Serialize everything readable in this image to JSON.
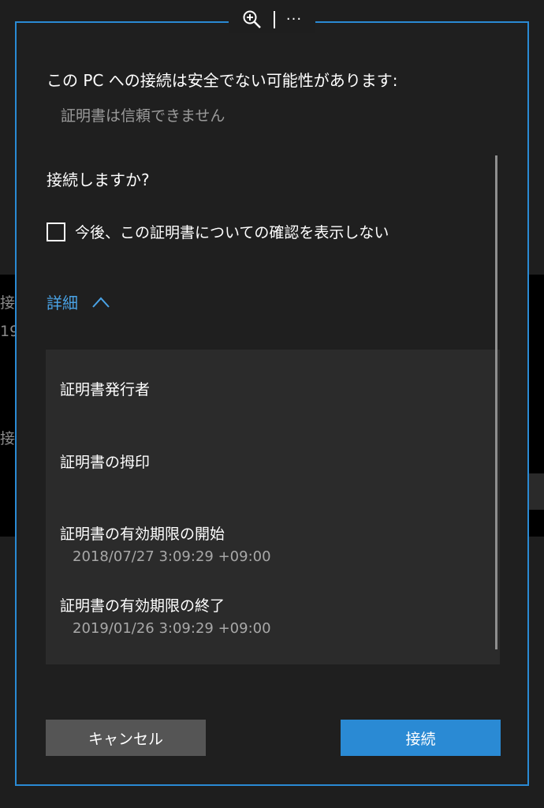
{
  "background": {
    "text_1": "接",
    "text_2": "19",
    "text_3": "接"
  },
  "topbar": {
    "zoom_icon": "zoom-in-icon",
    "more_label": "···"
  },
  "dialog": {
    "title": "この PC への接続は安全でない可能性があります:",
    "subtitle": "証明書は信頼できません",
    "question": "接続しますか?",
    "checkbox_label": "今後、この証明書についての確認を表示しない",
    "details_toggle_label": "詳細",
    "details": [
      {
        "label": "証明書発行者",
        "value": ""
      },
      {
        "label": "証明書の拇印",
        "value": ""
      },
      {
        "label": "証明書の有効期限の開始",
        "value": "2018/07/27 3:09:29 +09:00"
      },
      {
        "label": "証明書の有効期限の終了",
        "value": "2019/01/26 3:09:29 +09:00"
      }
    ],
    "cancel_label": "キャンセル",
    "connect_label": "接続"
  },
  "colors": {
    "accent": "#2a8ad4",
    "link": "#4aa3e6",
    "dialog_bg": "#1f1f1f",
    "panel_bg": "#2b2b2b",
    "cancel_bg": "#555555"
  }
}
